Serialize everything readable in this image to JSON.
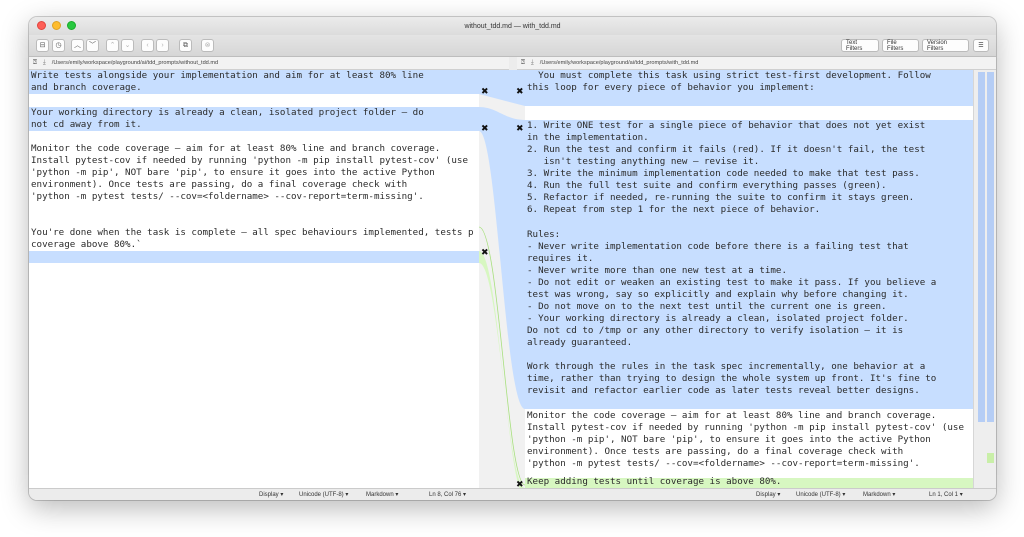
{
  "window": {
    "title": "without_tdd.md — with_tdd.md"
  },
  "toolbar": {
    "text_filters": "Text Filters",
    "file_filters": "File Filters",
    "version_filters": "Version Filters",
    "menu_icon": "hamburger-icon"
  },
  "left": {
    "path": "/Users/emily/workspace/playground/ai/tdd_prompts/without_tdd.md",
    "lines": [
      "Write tests alongside your implementation and aim for at least 80% line",
      "and branch coverage.",
      "",
      "Your working directory is already a clean, isolated project folder — do",
      "not cd away from it.",
      "",
      "Monitor the code coverage — aim for at least 80% line and branch coverage.",
      "Install pytest-cov if needed by running 'python -m pip install pytest-cov' (use",
      "'python -m pip', NOT bare 'pip', to ensure it goes into the active Python",
      "environment). Once tests are passing, do a final coverage check with",
      "'python -m pytest tests/ --cov=<foldername> --cov-report=term-missing'.",
      "",
      "You're done when the task is complete — all spec behaviours implemented, tests p",
      "coverage above 80%.`"
    ],
    "status": {
      "display": "Display",
      "encoding": "Unicode (UTF-8)",
      "syntax": "Markdown",
      "position": "Ln 8, Col 76"
    }
  },
  "right": {
    "path": "/Users/emily/workspace/playground/ai/tdd_prompts/with_tdd.md",
    "lines": [
      "  You must complete this task using strict test-first development. Follow",
      "this loop for every piece of behavior you implement:",
      "",
      "1. Write ONE test for a single piece of behavior that does not yet exist",
      "in the implementation.",
      "2. Run the test and confirm it fails (red). If it doesn't fail, the test",
      "   isn't testing anything new — revise it.",
      "3. Write the minimum implementation code needed to make that test pass.",
      "4. Run the full test suite and confirm everything passes (green).",
      "5. Refactor if needed, re-running the suite to confirm it stays green.",
      "6. Repeat from step 1 for the next piece of behavior.",
      "",
      "Rules:",
      "- Never write implementation code before there is a failing test that",
      "requires it.",
      "- Never write more than one new test at a time.",
      "- Do not edit or weaken an existing test to make it pass. If you believe a",
      "test was wrong, say so explicitly and explain why before changing it.",
      "- Do not move on to the next test until the current one is green.",
      "- Your working directory is already a clean, isolated project folder.",
      "Do not cd to /tmp or any other directory to verify isolation — it is",
      "already guaranteed.",
      "",
      "Work through the rules in the task spec incrementally, one behavior at a",
      "time, rather than trying to design the whole system up front. It's fine to",
      "revisit and refactor earlier code as later tests reveal better designs.",
      "",
      "Monitor the code coverage — aim for at least 80% line and branch coverage.",
      "Install pytest-cov if needed by running 'python -m pip install pytest-cov' (use",
      "'python -m pip', NOT bare 'pip', to ensure it goes into the active Python",
      "environment). Once tests are passing, do a final coverage check with",
      "'python -m pytest tests/ --cov=<foldername> --cov-report=term-missing'.",
      "Keep adding tests until coverage is above 80%."
    ],
    "status": {
      "display": "Display",
      "encoding": "Unicode (UTF-8)",
      "syntax": "Markdown",
      "position": "Ln 1, Col 1"
    }
  },
  "colors": {
    "changed": "#c7deff",
    "added": "#d7f7c1",
    "connector_blue": "#9ec3ef",
    "connector_green": "#a8e07e"
  }
}
